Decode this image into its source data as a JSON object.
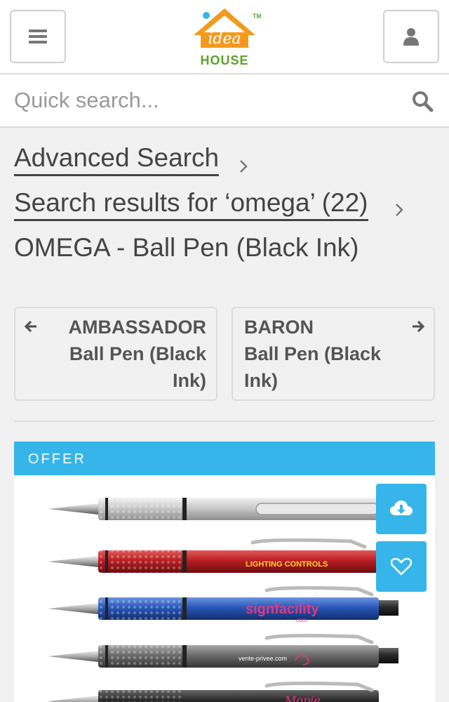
{
  "header": {
    "logo_word": "HOUSE",
    "logo_script": "idea",
    "logo_tm": "TM",
    "brand_orange": "#f39a1e",
    "brand_green": "#5aa42a"
  },
  "search": {
    "placeholder": "Quick search..."
  },
  "breadcrumb": {
    "advanced": "Advanced Search",
    "results": "Search results for ‘omega’ (22)",
    "current": "OMEGA - Ball Pen (Black Ink)"
  },
  "nav": {
    "prev_title": "AMBASSADOR",
    "prev_sub": "Ball Pen (Black Ink)",
    "next_title": "BARON",
    "next_sub": "Ball Pen (Black Ink)"
  },
  "offer": {
    "label": "OFFER",
    "accent": "#35b5ea"
  },
  "product_image": {
    "pen_logos": [
      "LIGHTING CONTROLS",
      "signfacility",
      ".com",
      "vente-privee.com",
      "Mopie"
    ]
  },
  "icons": {
    "menu": "hamburger-icon",
    "user": "user-icon",
    "search": "search-icon",
    "download": "cloud-download-icon",
    "wishlist": "heart-icon"
  }
}
